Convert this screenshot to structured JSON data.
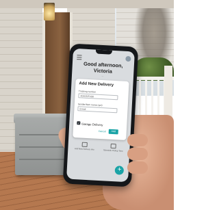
{
  "app": {
    "greeting": "Good afternoon,",
    "user_name": "Victoria",
    "location": "...",
    "icons": [
      "menu-icon",
      "avatar",
      "check-icon",
      "truck-icon",
      "package-icon"
    ]
  },
  "dialog": {
    "title": "Add New Delivery",
    "tracking_label": "Tracking number",
    "tracking_value": "4D62DFA98",
    "sender_label": "Sender/Item name (opt)",
    "sender_value": "Email",
    "garage_delivery_label": "Garage Delivery",
    "garage_delivery_checked": true,
    "cancel_label": "Cancel",
    "add_label": "Add"
  },
  "actions": {
    "left": "Add New Delivery Info",
    "right": "Schedule Pickup Time"
  },
  "fab_label": "+",
  "colors": {
    "accent": "#1aa3a6",
    "phone_body": "#15171a"
  }
}
